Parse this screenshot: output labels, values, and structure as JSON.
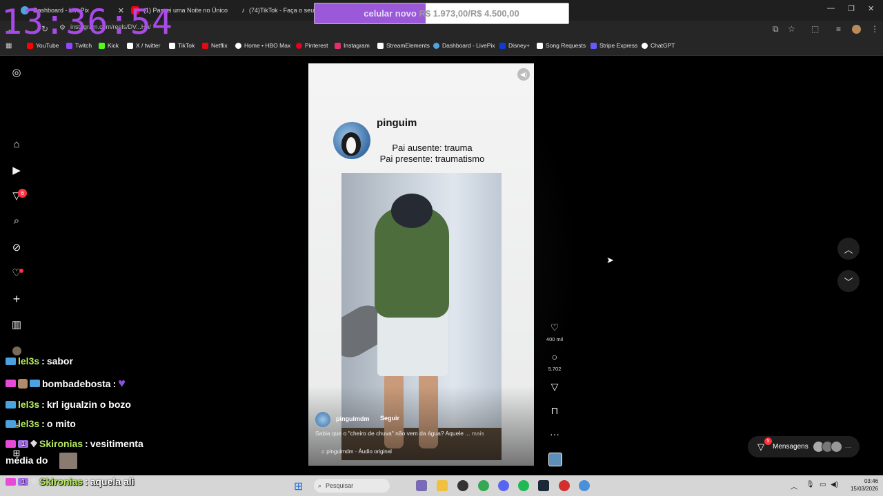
{
  "overlay": {
    "clock": "13:36:54",
    "goal": {
      "label": "celular novo",
      "amount": "R$ 1.973,00/R$ 4.500,00",
      "progress": 0.438
    }
  },
  "browser": {
    "tabs": [
      {
        "title": "Dashboard - LivePix",
        "icon": "livepix-icon",
        "color": "#4fa3e0"
      },
      {
        "title": "(1) Passei uma Noite no Único",
        "icon": "youtube-icon",
        "color": "#ff0000"
      },
      {
        "title": "(74)TikTok - Faça o seu di",
        "icon": "tiktok-icon",
        "color": "#ffffff"
      }
    ],
    "url": "instagram.com/reels/DV...Hn/",
    "bookmarks": [
      {
        "label": "YouTube",
        "color": "#ff0000"
      },
      {
        "label": "Twitch",
        "color": "#9146ff"
      },
      {
        "label": "Kick",
        "color": "#53fc18"
      },
      {
        "label": "X / twitter",
        "color": "#ffffff"
      },
      {
        "label": "TikTok",
        "color": "#ffffff"
      },
      {
        "label": "Netflix",
        "color": "#e50914"
      },
      {
        "label": "Home • HBO Max",
        "color": "#ffffff"
      },
      {
        "label": "Pinterest",
        "color": "#e60023"
      },
      {
        "label": "Instagram",
        "color": "#e1306c"
      },
      {
        "label": "StreamElements",
        "color": "#ffffff"
      },
      {
        "label": "Dashboard - LivePix",
        "color": "#4fa3e0"
      },
      {
        "label": "Disney+",
        "color": "#113ccf"
      },
      {
        "label": "Song Requests",
        "color": "#ffffff"
      },
      {
        "label": "Stripe Express",
        "color": "#635bff"
      },
      {
        "label": "ChatGPT",
        "color": "#ffffff"
      }
    ]
  },
  "instagram": {
    "nav_badge": "6",
    "reel": {
      "meme_user": "pinguim",
      "meme_line1": "Pai ausente: trauma",
      "meme_line2": "Pai presente: traumatismo",
      "author": "pinguimdm",
      "follow": "Seguir",
      "caption": "Sabia que o \"cheiro de chuva\" não vem da água? Aquele ...",
      "more": "mais",
      "audio": "pinguimdm · Áudio original",
      "likes": "400 mil",
      "comments": "5.702"
    },
    "messages": {
      "label": "Mensagens",
      "badge": "5"
    }
  },
  "chat": [
    {
      "user": "lel3s",
      "text": "sabor",
      "color": "#b8ec60"
    },
    {
      "user": "bombadebosta",
      "text": "",
      "color": "#ffffff"
    },
    {
      "user": "lel3s",
      "text": "krl igualzin o bozo",
      "color": "#b8ec60"
    },
    {
      "user": "lel3s",
      "text": "o mito",
      "color": "#b8ec60"
    },
    {
      "user": "Skironias",
      "text": "vesitimenta",
      "color": "#b8ec60"
    },
    {
      "user": "",
      "text": "média do",
      "color": "#ffffff"
    },
    {
      "user": "Skironias",
      "text": "aquela ali",
      "color": "#b8ec60"
    }
  ],
  "taskbar": {
    "search": "Pesquisar",
    "time": "03:46",
    "date": "15/03/2026"
  }
}
